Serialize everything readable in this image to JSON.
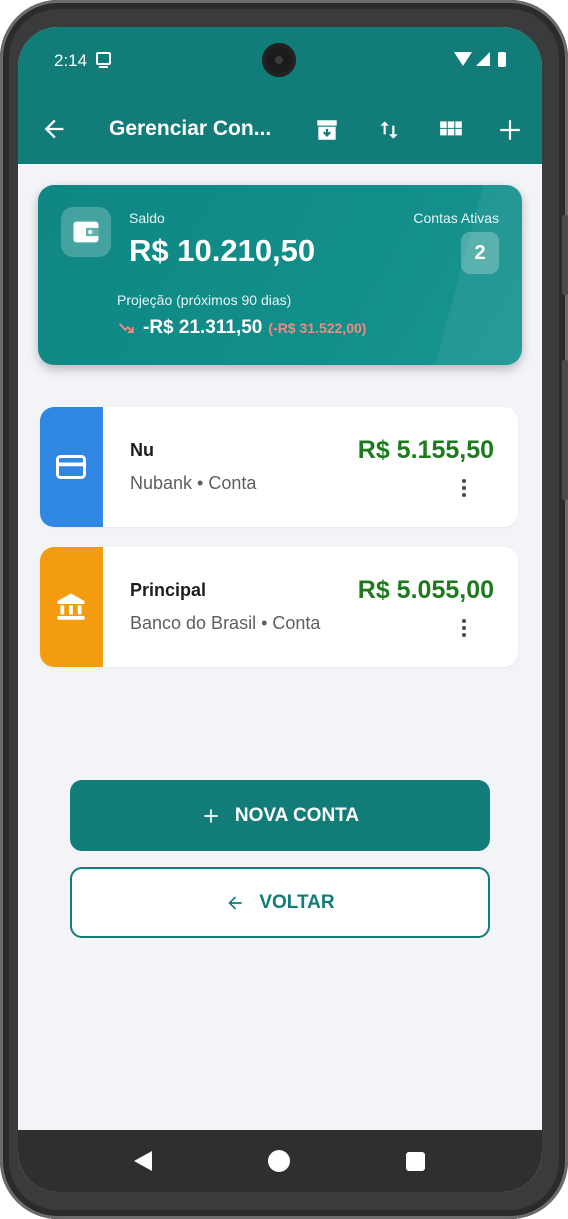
{
  "status": {
    "time": "2:14"
  },
  "appbar": {
    "title": "Gerenciar Con...",
    "icons": [
      "back-arrow-icon",
      "archive-icon",
      "sort-icon",
      "grid-view-icon",
      "add-icon"
    ]
  },
  "summary": {
    "saldo_label": "Saldo",
    "saldo_value": "R$ 10.210,50",
    "contas_label": "Contas Ativas",
    "contas_count": "2",
    "projecao_label": "Projeção (próximos 90 dias)",
    "projecao_value": "-R$ 21.311,50",
    "projecao_diff": "(-R$ 31.522,00)",
    "colors": {
      "card": "#117c78",
      "diff": "#f08a80"
    }
  },
  "accounts": [
    {
      "name": "Nu",
      "subtitle": "Nubank • Conta",
      "amount": "R$ 5.155,50",
      "icon": "credit-card-icon",
      "color": "#2f86e3"
    },
    {
      "name": "Principal",
      "subtitle": "Banco do Brasil • Conta",
      "amount": "R$ 5.055,00",
      "icon": "bank-icon",
      "color": "#f39c0f"
    }
  ],
  "actions": {
    "new_account_label": "NOVA CONTA",
    "back_label": "VOLTAR"
  },
  "colors": {
    "primary": "#117c78",
    "positive_amount": "#1d7a1d",
    "background": "#f2f4f8"
  }
}
